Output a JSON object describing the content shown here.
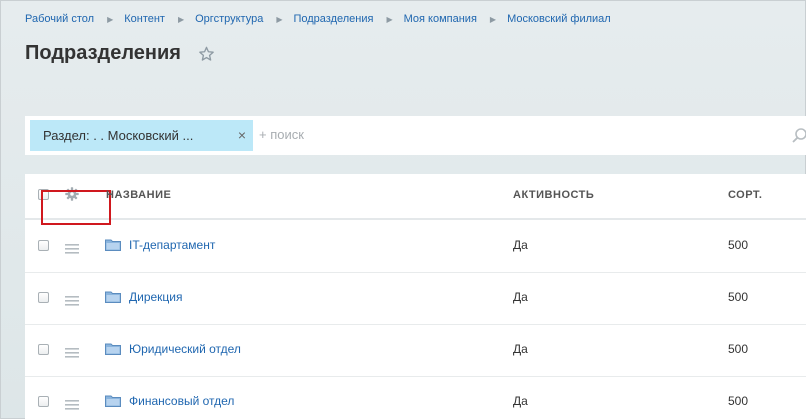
{
  "breadcrumb": [
    "Рабочий стол",
    "Контент",
    "Оргструктура",
    "Подразделения",
    "Моя компания",
    "Московский филиал"
  ],
  "page": {
    "title": "Подразделения"
  },
  "filter": {
    "chip_label": "Раздел: . . Московский ...",
    "chip_close": "×",
    "placeholder": "+ поиск"
  },
  "table": {
    "columns": {
      "name": "НАЗВАНИЕ",
      "active": "АКТИВНОСТЬ",
      "sort": "СОРТ."
    },
    "rows": [
      {
        "name": "IT-департамент",
        "active": "Да",
        "sort": "500"
      },
      {
        "name": "Дирекция",
        "active": "Да",
        "sort": "500"
      },
      {
        "name": "Юридический отдел",
        "active": "Да",
        "sort": "500"
      },
      {
        "name": "Финансовый отдел",
        "active": "Да",
        "sort": "500"
      }
    ]
  },
  "icons": {
    "star": "star-outline-icon",
    "gear": "gear-icon",
    "drag": "drag-handle-icon",
    "folder": "folder-icon",
    "search": "search-icon"
  },
  "colors": {
    "link": "#2067b0",
    "chip": "#bce8f8",
    "highlight": "#d0181e",
    "folder": "#8ab4dd"
  }
}
